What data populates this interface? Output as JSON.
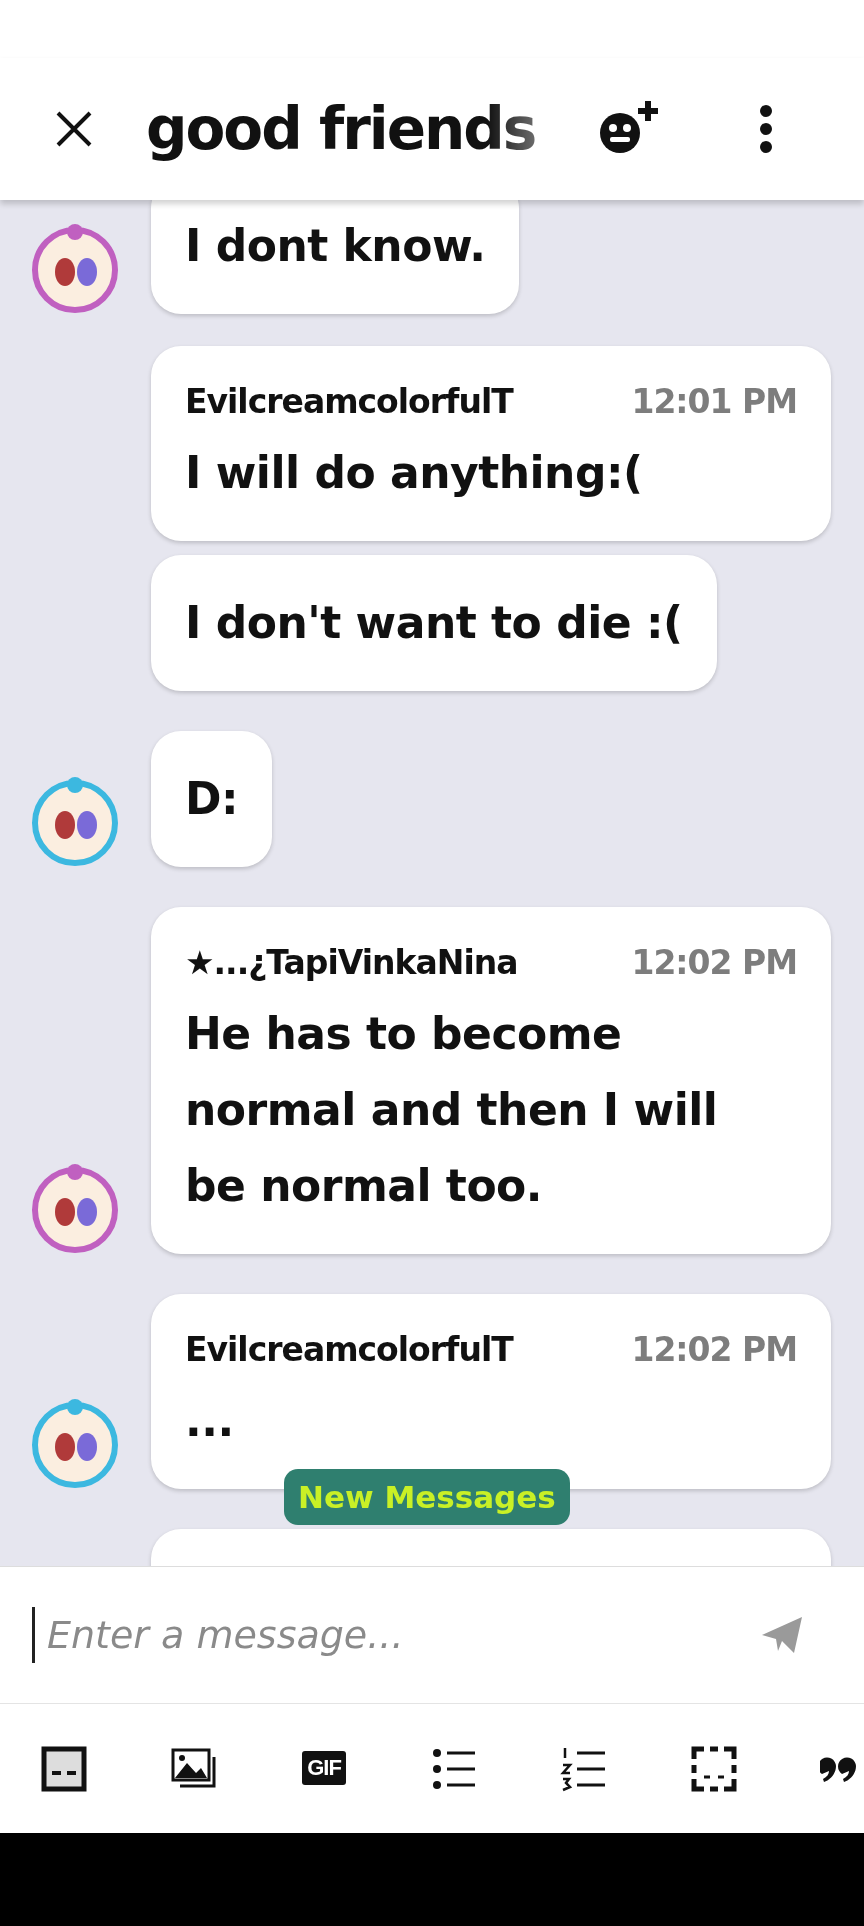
{
  "header": {
    "title": "good friends"
  },
  "messages": [
    {
      "avatar": {
        "color": "#c060c0"
      },
      "text": "I dont know."
    },
    {
      "author": "EvilcreamcolorfulT",
      "time": "12:01 PM",
      "text": "I will do anything:("
    },
    {
      "text": "I don't want to die :("
    },
    {
      "avatar": {
        "color": "#3cb8e0"
      },
      "text": "D:"
    },
    {
      "author": "★...¿TapiVinkaNina",
      "time": "12:02 PM",
      "text": "He has to become normal and then I will be normal too.",
      "avatar": {
        "color": "#c060c0"
      }
    },
    {
      "author": "EvilcreamcolorfulT",
      "time": "12:02 PM",
      "text": "...",
      "avatar": {
        "color": "#3cb8e0"
      }
    },
    {
      "kind": "cut"
    }
  ],
  "new_messages": "New Messages",
  "composer": {
    "placeholder": "Enter a message..."
  },
  "toolbar": [
    {
      "kind": "sticker"
    },
    {
      "kind": "image"
    },
    {
      "kind": "gif",
      "label": "GIF"
    },
    {
      "kind": "bullets"
    },
    {
      "kind": "numbers"
    },
    {
      "kind": "frame"
    },
    {
      "kind": "quote"
    }
  ]
}
